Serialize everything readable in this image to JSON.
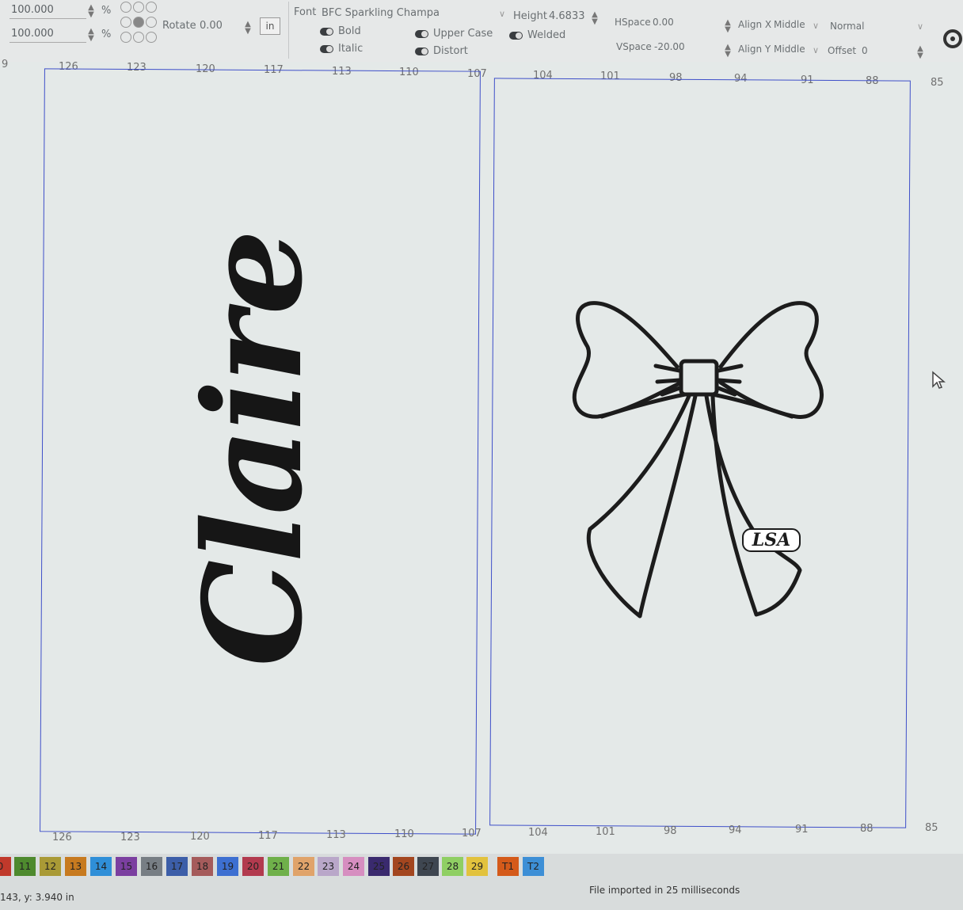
{
  "toolbar": {
    "scale_x": "100.000",
    "scale_y": "100.000",
    "percent": "%",
    "rotate_label": "Rotate",
    "rotate_value": "0.00",
    "unit_button": "in",
    "font_label": "Font",
    "font_value": "BFC Sparkling Champa",
    "height_label": "Height",
    "height_value": "4.6833",
    "hspace_label": "HSpace",
    "hspace_value": "0.00",
    "vspace_label": "VSpace",
    "vspace_value": "-20.00",
    "align_x_label": "Align X",
    "align_x_value": "Middle",
    "align_y_label": "Align Y",
    "align_y_value": "Middle",
    "mode_value": "Normal",
    "offset_label": "Offset",
    "offset_value": "0",
    "bold": "Bold",
    "italic": "Italic",
    "upper_case": "Upper Case",
    "distort": "Distort",
    "welded": "Welded"
  },
  "canvas": {
    "top_ruler": [
      "9",
      "126",
      "123",
      "120",
      "117",
      "113",
      "110",
      "107",
      "104",
      "101",
      "98",
      "94",
      "91",
      "88",
      "85"
    ],
    "bottom_ruler": [
      "126",
      "123",
      "120",
      "117",
      "113",
      "110",
      "107",
      "104",
      "101",
      "98",
      "94",
      "91",
      "88",
      "85"
    ],
    "text_object": "Claire",
    "bow_logo": "LSA"
  },
  "palette": [
    {
      "label": "0",
      "color": "#c0392b"
    },
    {
      "label": "11",
      "color": "#4e8a2e"
    },
    {
      "label": "12",
      "color": "#a99a36"
    },
    {
      "label": "13",
      "color": "#c77a1f"
    },
    {
      "label": "14",
      "color": "#2f8fd8"
    },
    {
      "label": "15",
      "color": "#7b3fa0"
    },
    {
      "label": "16",
      "color": "#777e84"
    },
    {
      "label": "17",
      "color": "#3c5ea8"
    },
    {
      "label": "18",
      "color": "#a55b5b"
    },
    {
      "label": "19",
      "color": "#3d6fd1"
    },
    {
      "label": "20",
      "color": "#b23a4e"
    },
    {
      "label": "21",
      "color": "#6fb04a"
    },
    {
      "label": "22",
      "color": "#e0a36a"
    },
    {
      "label": "23",
      "color": "#b9a7c9"
    },
    {
      "label": "24",
      "color": "#d68ec0"
    },
    {
      "label": "25",
      "color": "#3a2a6e"
    },
    {
      "label": "26",
      "color": "#a3461f"
    },
    {
      "label": "27",
      "color": "#3e4650"
    },
    {
      "label": "28",
      "color": "#8fcf63"
    },
    {
      "label": "29",
      "color": "#e2c23d"
    },
    {
      "label": "T1",
      "color": "#d45a1a"
    },
    {
      "label": "T2",
      "color": "#3d8fd6"
    }
  ],
  "status": {
    "coords": "143, y: 3.940 in",
    "message": "File imported in 25 milliseconds"
  }
}
